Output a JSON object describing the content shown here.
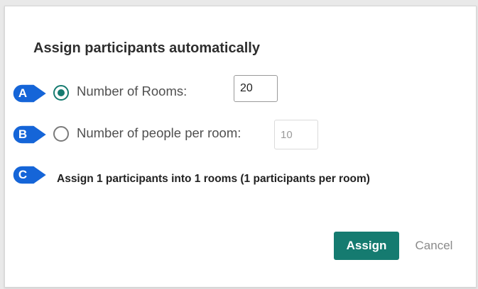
{
  "dialog": {
    "title": "Assign participants automatically",
    "options": [
      {
        "callout": "A",
        "label": "Number of Rooms:",
        "value": "20",
        "selected": true
      },
      {
        "callout": "B",
        "label": "Number of people per room:",
        "value": "10",
        "selected": false
      }
    ],
    "summary_callout": "C",
    "summary": "Assign 1 participants into 1 rooms (1 participants per room)",
    "buttons": {
      "assign": "Assign",
      "cancel": "Cancel"
    }
  },
  "colors": {
    "accent": "#157b70",
    "callout_blue": "#1565d8"
  },
  "icons": {
    "callout_shape": "callout-arrow-badge",
    "radio_checked": "radio-checked-icon",
    "radio_unchecked": "radio-unchecked-icon"
  }
}
